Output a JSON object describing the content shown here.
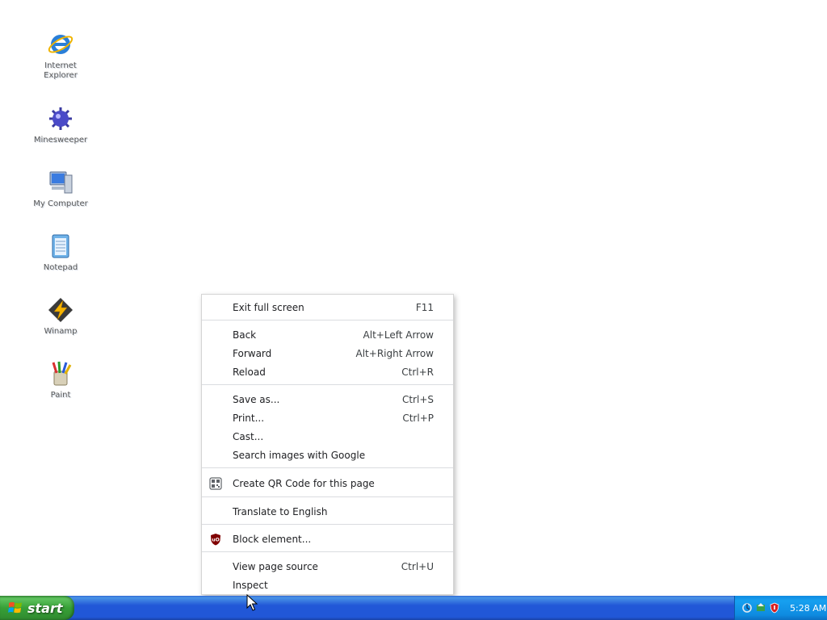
{
  "desktop": {
    "icons": [
      {
        "label": "Internet\nExplorer",
        "icon": "internet-explorer-icon"
      },
      {
        "label": "Minesweeper",
        "icon": "minesweeper-icon"
      },
      {
        "label": "My Computer",
        "icon": "my-computer-icon"
      },
      {
        "label": "Notepad",
        "icon": "notepad-icon"
      },
      {
        "label": "Winamp",
        "icon": "winamp-icon"
      },
      {
        "label": "Paint",
        "icon": "paint-icon"
      }
    ]
  },
  "context_menu": {
    "items": [
      {
        "label": "Exit full screen",
        "shortcut": "F11"
      },
      {
        "label": "Back",
        "shortcut": "Alt+Left Arrow"
      },
      {
        "label": "Forward",
        "shortcut": "Alt+Right Arrow"
      },
      {
        "label": "Reload",
        "shortcut": "Ctrl+R"
      },
      {
        "label": "Save as...",
        "shortcut": "Ctrl+S"
      },
      {
        "label": "Print...",
        "shortcut": "Ctrl+P"
      },
      {
        "label": "Cast...",
        "shortcut": ""
      },
      {
        "label": "Search images with Google",
        "shortcut": ""
      },
      {
        "label": "Create QR Code for this page",
        "shortcut": "",
        "icon": "qr-code-icon"
      },
      {
        "label": "Translate to English",
        "shortcut": ""
      },
      {
        "label": "Block element...",
        "shortcut": "",
        "icon": "ublock-origin-icon"
      },
      {
        "label": "View page source",
        "shortcut": "Ctrl+U"
      },
      {
        "label": "Inspect",
        "shortcut": ""
      }
    ]
  },
  "taskbar": {
    "start_label": "start",
    "tray_icons": [
      "network-icon",
      "update-icon",
      "security-shield-icon"
    ],
    "clock": "5:28 AM"
  },
  "colors": {
    "taskbar_blue": "#2157d7",
    "start_green": "#37a037",
    "tray_blue": "#0e8ae0"
  }
}
